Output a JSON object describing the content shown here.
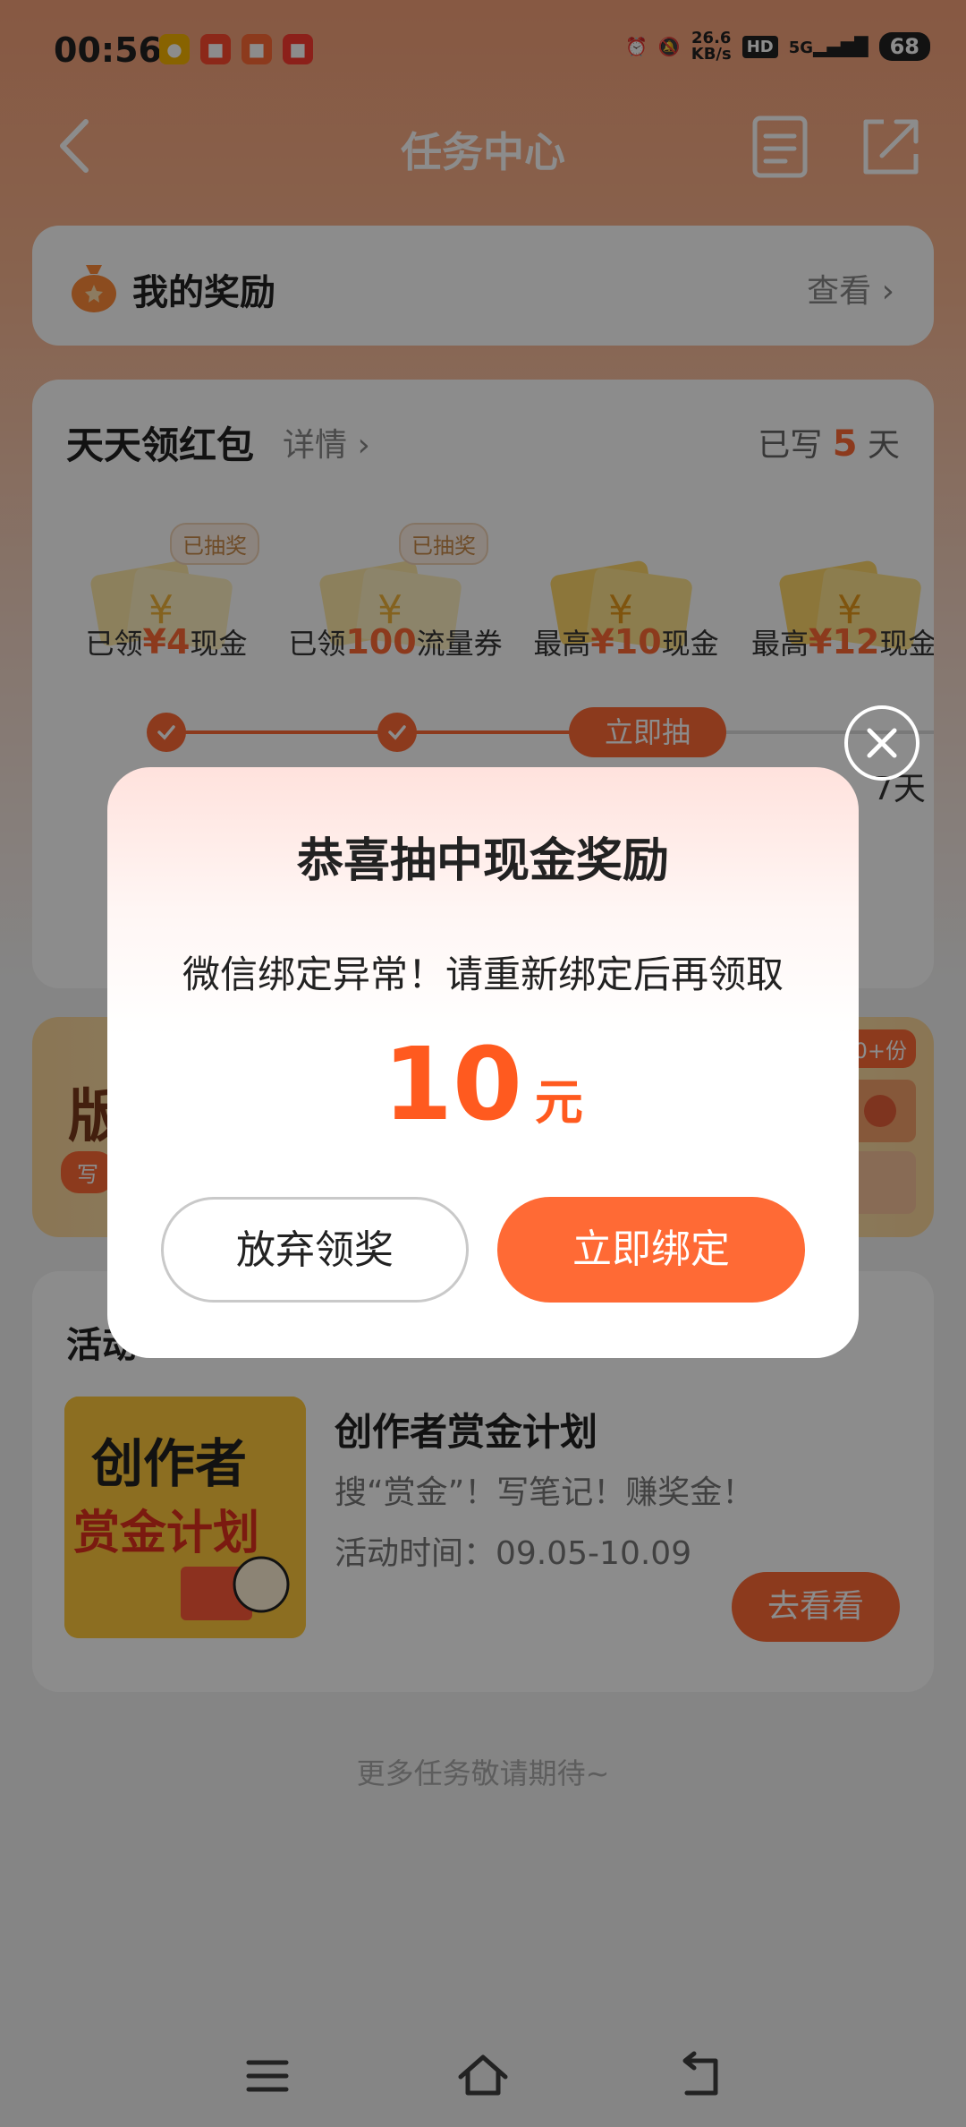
{
  "status_bar": {
    "time": "00:56",
    "net_speed_value": "26.6",
    "net_speed_unit": "KB/s",
    "hd": "HD",
    "network": "5G",
    "battery": "68"
  },
  "header": {
    "title": "任务中心"
  },
  "rewards": {
    "title": "我的奖励",
    "view": "查看 ›"
  },
  "daily": {
    "title": "天天领红包",
    "detail": "详情 ›",
    "streak_prefix": "已写",
    "streak_days": "5",
    "streak_suffix": "天",
    "prizes": [
      {
        "badge": "已抽奖",
        "pre": "已领",
        "hl": "¥4",
        "post": "现金"
      },
      {
        "badge": "已抽奖",
        "pre": "已领",
        "hl": "100",
        "post": "流量券"
      },
      {
        "badge": "",
        "pre": "最高",
        "hl": "¥10",
        "post": "现金"
      },
      {
        "badge": "",
        "pre": "最高",
        "hl": "¥12",
        "post": "现金"
      }
    ],
    "draw_now": "立即抽",
    "day_label": "7天"
  },
  "banner": {
    "text": "版",
    "tag": "写",
    "badge": "0+份"
  },
  "activity": {
    "title": "活动",
    "name": "创作者赏金计划",
    "desc": "搜“赏金”！写笔记！赚奖金！",
    "time": "活动时间：09.05-10.09",
    "button": "去看看",
    "image_text_1": "创作者",
    "image_text_2": "赏金计划"
  },
  "more_tip": "更多任务敬请期待~",
  "dialog": {
    "title": "恭喜抽中现金奖励",
    "message": "微信绑定异常！请重新绑定后再领取",
    "amount": "10",
    "unit": "元",
    "abandon_button": "放弃领奖",
    "bind_button": "立即绑定"
  },
  "colors": {
    "accent": "#ff6a35",
    "amount": "#ff5a1f"
  }
}
